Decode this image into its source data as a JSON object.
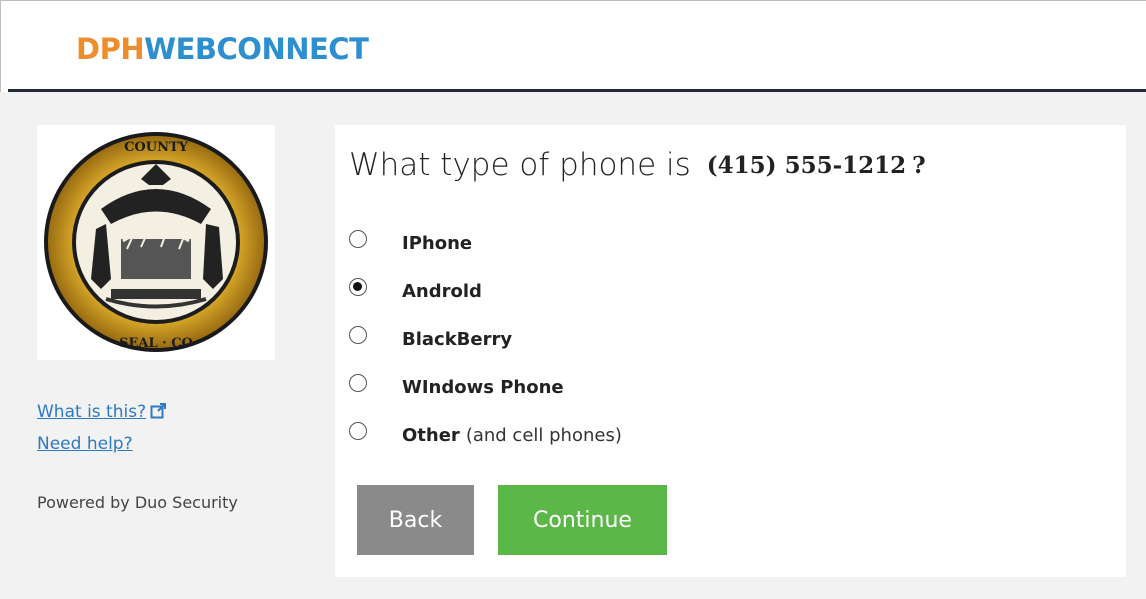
{
  "header": {
    "brand_part1": "DPH",
    "brand_part2": "WEBCONNECT",
    "brand_part1_color": "#ef8c2b",
    "brand_part2_color": "#2e8fd0"
  },
  "sidebar": {
    "logo_icon": "city-seal-icon",
    "links": [
      {
        "label": "What is this?",
        "icon": "external-link-icon"
      },
      {
        "label": "Need help?"
      }
    ],
    "powered_by": "Powered by Duo Security"
  },
  "prompt": {
    "question": "What type of phone is",
    "phone_number": "(415) 555-1212",
    "question_mark": "?"
  },
  "options": [
    {
      "label": "IPhone",
      "sub": "",
      "selected": false
    },
    {
      "label": "Androld",
      "sub": "",
      "selected": true
    },
    {
      "label": "BlackBerry",
      "sub": "",
      "selected": false
    },
    {
      "label": "WIndows Phone",
      "sub": "",
      "selected": false
    },
    {
      "label": "Other",
      "sub": "(and cell phones)",
      "selected": false
    }
  ],
  "buttons": {
    "back_label": "Back",
    "continue_label": "Continue",
    "back_color": "#8a8a8a",
    "continue_color": "#5bb848"
  }
}
